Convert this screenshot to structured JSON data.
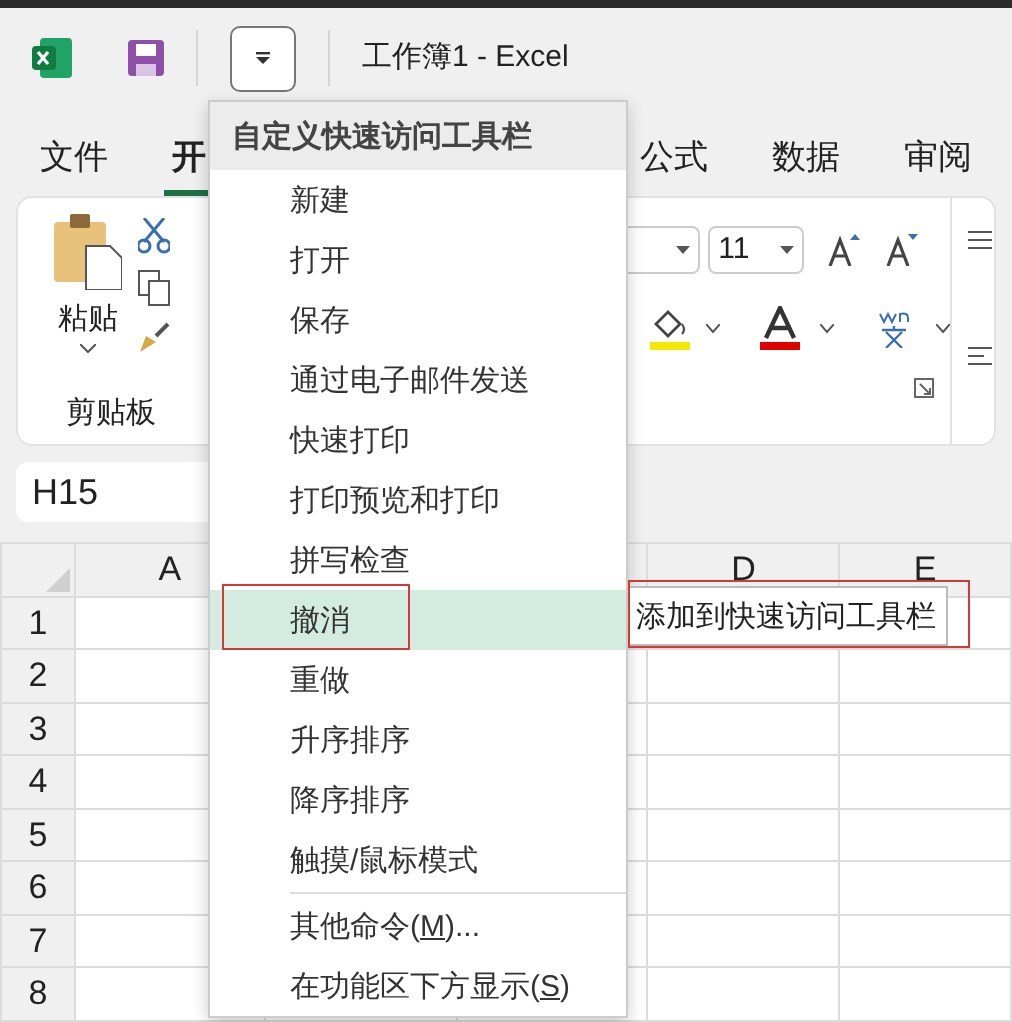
{
  "window": {
    "title": "工作簿1  -  Excel"
  },
  "tabs": [
    {
      "label": "文件",
      "selected": false
    },
    {
      "label": "开",
      "selected": true
    },
    {
      "label": "公式",
      "selected": false
    },
    {
      "label": "数据",
      "selected": false
    },
    {
      "label": "审阅",
      "selected": false
    }
  ],
  "ribbon": {
    "clipboard": {
      "paste_label": "粘贴",
      "group_label": "剪贴板"
    },
    "font": {
      "size": "11"
    }
  },
  "name_box": {
    "value": "H15"
  },
  "grid": {
    "columns": [
      "A",
      "D",
      "E"
    ],
    "rows": [
      "1",
      "2",
      "3",
      "4",
      "5",
      "6",
      "7",
      "8"
    ]
  },
  "menu": {
    "title": "自定义快速访问工具栏",
    "items": [
      {
        "label": "新建",
        "selected": false,
        "outlined": false
      },
      {
        "label": "打开",
        "selected": false,
        "outlined": false
      },
      {
        "label": "保存",
        "selected": false,
        "outlined": false
      },
      {
        "label": "通过电子邮件发送",
        "selected": false,
        "outlined": false
      },
      {
        "label": "快速打印",
        "selected": false,
        "outlined": false
      },
      {
        "label": "打印预览和打印",
        "selected": false,
        "outlined": false
      },
      {
        "label": "拼写检查",
        "selected": false,
        "outlined": false
      },
      {
        "label": "撤消",
        "selected": true,
        "outlined": true
      },
      {
        "label": "重做",
        "selected": false,
        "outlined": false
      },
      {
        "label": "升序排序",
        "selected": false,
        "outlined": false
      },
      {
        "label": "降序排序",
        "selected": false,
        "outlined": false
      },
      {
        "label": "触摸/鼠标模式",
        "selected": false,
        "outlined": false
      }
    ],
    "more_items": [
      {
        "before": "其他命令(",
        "mnemonic": "M",
        "after": ")..."
      },
      {
        "before": "在功能区下方显示(",
        "mnemonic": "S",
        "after": ")"
      }
    ]
  },
  "tooltip": {
    "text": "添加到快速访问工具栏",
    "outlined": true
  }
}
